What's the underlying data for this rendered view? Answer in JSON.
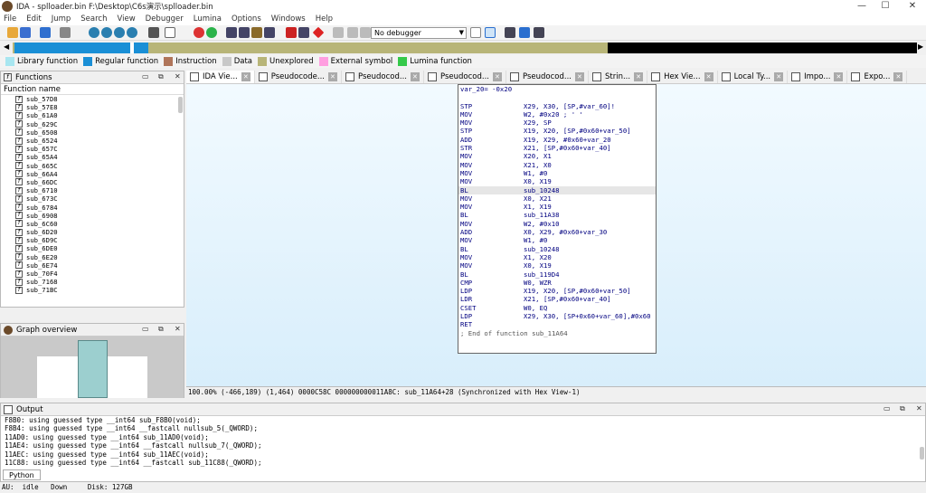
{
  "window": {
    "title": "IDA - splloader.bin F:\\Desktop\\C6s演示\\splloader.bin",
    "minimize": "—",
    "maximize": "☐",
    "close": "✕"
  },
  "menu": [
    "File",
    "Edit",
    "Jump",
    "Search",
    "View",
    "Debugger",
    "Lumina",
    "Options",
    "Windows",
    "Help"
  ],
  "toolbar": {
    "debugger_select": "No debugger"
  },
  "colors": {
    "library": "#a8e6f0",
    "regular": "#1a8fd6",
    "instruction": "#b0755a",
    "data": "#c8c8c8",
    "unexplored": "#b8b578",
    "external": "#ff9ee0",
    "lumina": "#35c94a"
  },
  "legend": [
    {
      "label": "Library function",
      "color": "#a8e6f0"
    },
    {
      "label": "Regular function",
      "color": "#1a8fd6"
    },
    {
      "label": "Instruction",
      "color": "#b0755a"
    },
    {
      "label": "Data",
      "color": "#c8c8c8"
    },
    {
      "label": "Unexplored",
      "color": "#b8b578"
    },
    {
      "label": "External symbol",
      "color": "#ff9ee0"
    },
    {
      "label": "Lumina function",
      "color": "#35c94a"
    }
  ],
  "functions": {
    "title": "Functions",
    "column": "Function name",
    "items": [
      "sub_57D8",
      "sub_57E8",
      "sub_61A0",
      "sub_629C",
      "sub_6508",
      "sub_6524",
      "sub_657C",
      "sub_65A4",
      "sub_665C",
      "sub_66A4",
      "sub_66DC",
      "sub_6710",
      "sub_673C",
      "sub_6784",
      "sub_6908",
      "sub_6C60",
      "sub_6D20",
      "sub_6D9C",
      "sub_6DE0",
      "sub_6E20",
      "sub_6E74",
      "sub_70F4",
      "sub_7168",
      "sub_71BC"
    ]
  },
  "graph": {
    "title": "Graph overview"
  },
  "tabs": [
    {
      "label": "IDA Vie...",
      "closable": "✕"
    },
    {
      "label": "Pseudocode...",
      "closable": "✕"
    },
    {
      "label": "Pseudocod...",
      "closable": "✕"
    },
    {
      "label": "Pseudocod...",
      "closable": "✕"
    },
    {
      "label": "Pseudocod...",
      "closable": "✕"
    },
    {
      "label": "Strin...",
      "closable": "✕"
    },
    {
      "label": "Hex Vie...",
      "closable": "✕"
    },
    {
      "label": "Local Ty...",
      "closable": "✕"
    },
    {
      "label": "Impo...",
      "closable": "✕"
    },
    {
      "label": "Expo...",
      "closable": "✕"
    }
  ],
  "disasm": {
    "header": "var_20= -0x20",
    "lines": [
      {
        "m": "STP",
        "o": "X29, X30, [SP,#var_60]!"
      },
      {
        "m": "MOV",
        "o": "W2, #0x20 ; ' '"
      },
      {
        "m": "MOV",
        "o": "X29, SP"
      },
      {
        "m": "STP",
        "o": "X19, X20, [SP,#0x60+var_50]"
      },
      {
        "m": "ADD",
        "o": "X19, X29, #0x60+var_20"
      },
      {
        "m": "STR",
        "o": "X21, [SP,#0x60+var_40]"
      },
      {
        "m": "MOV",
        "o": "X20, X1"
      },
      {
        "m": "MOV",
        "o": "X21, X0"
      },
      {
        "m": "MOV",
        "o": "W1, #0"
      },
      {
        "m": "MOV",
        "o": "X0, X19"
      },
      {
        "m": "BL",
        "o": "sub_10248"
      },
      {
        "m": "MOV",
        "o": "X0, X21"
      },
      {
        "m": "MOV",
        "o": "X1, X19"
      },
      {
        "m": "BL",
        "o": "sub_11A38"
      },
      {
        "m": "MOV",
        "o": "W2, #0x10"
      },
      {
        "m": "ADD",
        "o": "X0, X29, #0x60+var_30"
      },
      {
        "m": "MOV",
        "o": "W1, #0"
      },
      {
        "m": "BL",
        "o": "sub_10248"
      },
      {
        "m": "MOV",
        "o": "X1, X20"
      },
      {
        "m": "MOV",
        "o": "X0, X19"
      },
      {
        "m": "BL",
        "o": "sub_119D4"
      },
      {
        "m": "CMP",
        "o": "W0, WZR"
      },
      {
        "m": "LDP",
        "o": "X19, X20, [SP,#0x60+var_50]"
      },
      {
        "m": "LDR",
        "o": "X21, [SP,#0x60+var_40]"
      },
      {
        "m": "CSET",
        "o": "W0, EQ"
      },
      {
        "m": "LDP",
        "o": "X29, X30, [SP+0x60+var_60],#0x60"
      },
      {
        "m": "RET",
        "o": ""
      }
    ],
    "footer": "; End of function sub_11A64"
  },
  "status_line": "100.00% (-466,189) (1,464) 0000C58C 000000000011A8C: sub_11A64+28 (Synchronized with Hex View-1)",
  "output": {
    "title": "Output",
    "lines": [
      "F8B0: using guessed type __int64 sub_F8B0(void);",
      "F8B4: using guessed type __int64 __fastcall nullsub_5(_QWORD);",
      "11AD0: using guessed type __int64 sub_11AD0(void);",
      "11AE4: using guessed type __int64 __fastcall nullsub_7(_QWORD);",
      "11AEC: using guessed type __int64 sub_11AEC(void);",
      "11C88: using guessed type __int64 __fastcall sub_11C88(_QWORD);"
    ],
    "python_tab": "Python"
  },
  "statusbar": "AU:  idle   Down     Disk: 127GB"
}
